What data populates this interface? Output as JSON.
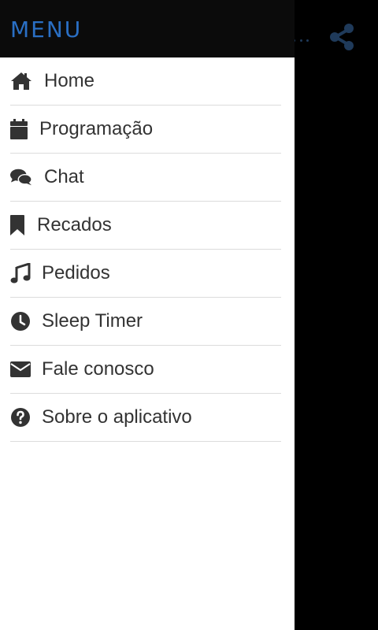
{
  "drawer": {
    "title": "MENU",
    "items": [
      {
        "label": "Home",
        "icon": "home-icon"
      },
      {
        "label": "Programação",
        "icon": "calendar-icon"
      },
      {
        "label": "Chat",
        "icon": "comments-icon"
      },
      {
        "label": "Recados",
        "icon": "bookmark-icon"
      },
      {
        "label": "Pedidos",
        "icon": "music-note-icon"
      },
      {
        "label": "Sleep Timer",
        "icon": "clock-icon"
      },
      {
        "label": "Fale conosco",
        "icon": "envelope-icon"
      },
      {
        "label": "Sobre o aplicativo",
        "icon": "question-circle-icon"
      }
    ]
  },
  "background_app": {
    "icons": [
      "more-dots-icon",
      "share-icon"
    ]
  },
  "colors": {
    "title": "#2a6fc4",
    "header_bg": "#0b0b0b",
    "drawer_bg": "#ffffff",
    "text": "#333333",
    "divider": "#dcdcdc",
    "share_icon": "#1f3a5a"
  }
}
